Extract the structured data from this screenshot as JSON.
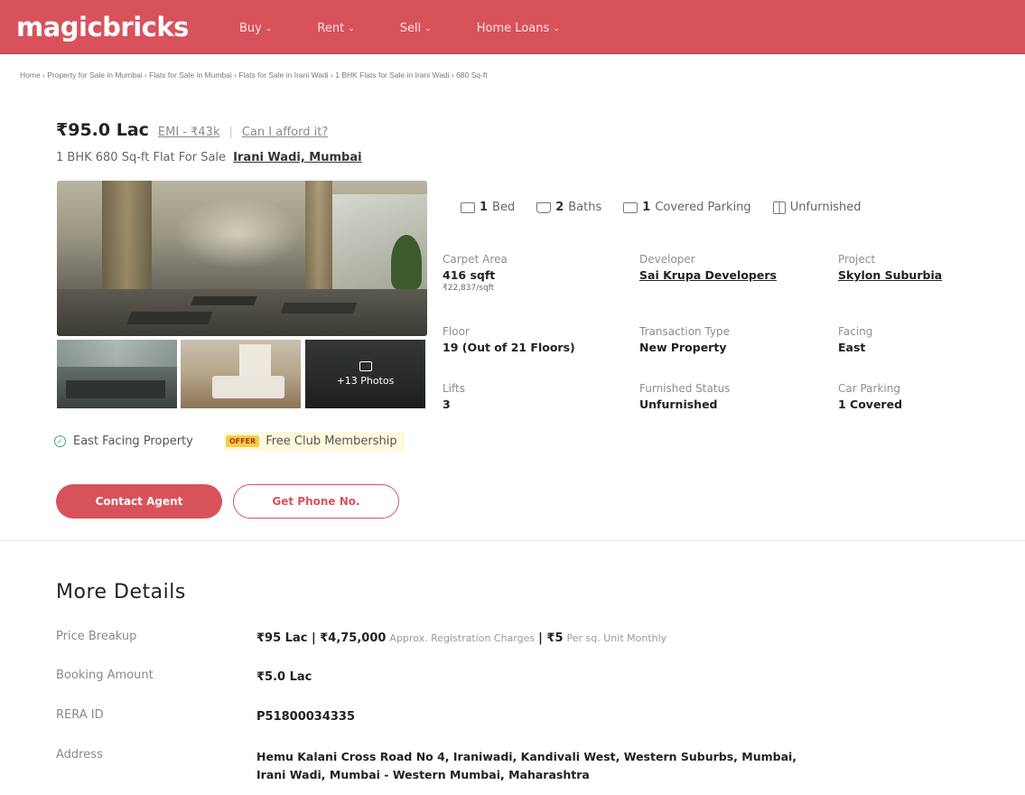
{
  "header": {
    "logo": "magicbricks",
    "nav": [
      {
        "label": "Buy"
      },
      {
        "label": "Rent"
      },
      {
        "label": "Sell"
      },
      {
        "label": "Home Loans"
      }
    ],
    "brand_color": "#d8525b"
  },
  "breadcrumb": "Home › Property for Sale in Mumbai › Flats for Sale in Mumbai › Flats for Sale in Irani Wadi › 1 BHK Flats for Sale in Irani Wadi › 680 Sq-ft",
  "summary": {
    "price": "₹95.0 Lac",
    "emi": "EMI - ₹43k",
    "separator": "|",
    "afford": "Can I afford it?",
    "subtitle": "1 BHK 680 Sq-ft Flat For Sale",
    "location": "Irani Wadi, Mumbai"
  },
  "gallery": {
    "more_photos": "+13 Photos"
  },
  "features": [
    {
      "icon": "bed-icon",
      "count": "1",
      "label": "Bed"
    },
    {
      "icon": "bath-icon",
      "count": "2",
      "label": "Baths"
    },
    {
      "icon": "parking-icon",
      "count": "1",
      "label": "Covered Parking"
    },
    {
      "icon": "furnish-icon",
      "count": "",
      "label": "Unfurnished"
    }
  ],
  "details": {
    "carpet_area": {
      "label": "Carpet Area",
      "value": "416 sqft",
      "sub": "₹22,837/sqft"
    },
    "developer": {
      "label": "Developer",
      "value": "Sai Krupa Developers"
    },
    "project": {
      "label": "Project",
      "value": "Skylon Suburbia"
    },
    "floor": {
      "label": "Floor",
      "value": "19 (Out of 21 Floors)"
    },
    "transaction": {
      "label": "Transaction Type",
      "value": "New Property"
    },
    "facing": {
      "label": "Facing",
      "value": "East"
    },
    "lifts": {
      "label": "Lifts",
      "value": "3"
    },
    "furnished": {
      "label": "Furnished Status",
      "value": "Unfurnished"
    },
    "car_parking": {
      "label": "Car Parking",
      "value": "1 Covered"
    }
  },
  "tags": {
    "facing": "East Facing Property",
    "offer_badge": "OFFER",
    "offer_text": "Free Club Membership"
  },
  "buttons": {
    "contact": "Contact Agent",
    "phone": "Get Phone No."
  },
  "more_details": {
    "title": "More Details",
    "rows": [
      {
        "label": "Price Breakup",
        "value": "₹95 Lac | ₹4,75,000",
        "muted": "Approx. Registration Charges",
        "extra": "| ₹5",
        "muted2": "Per sq. Unit Monthly"
      },
      {
        "label": "Booking Amount",
        "value": "₹5.0 Lac"
      },
      {
        "label": "RERA ID",
        "value": "P51800034335"
      },
      {
        "label": "Address",
        "value": "Hemu Kalani Cross Road No 4, Iraniwadi, Kandivali West, Western Suburbs, Mumbai,",
        "value2": "Irani Wadi, Mumbai - Western Mumbai, Maharashtra"
      }
    ]
  }
}
